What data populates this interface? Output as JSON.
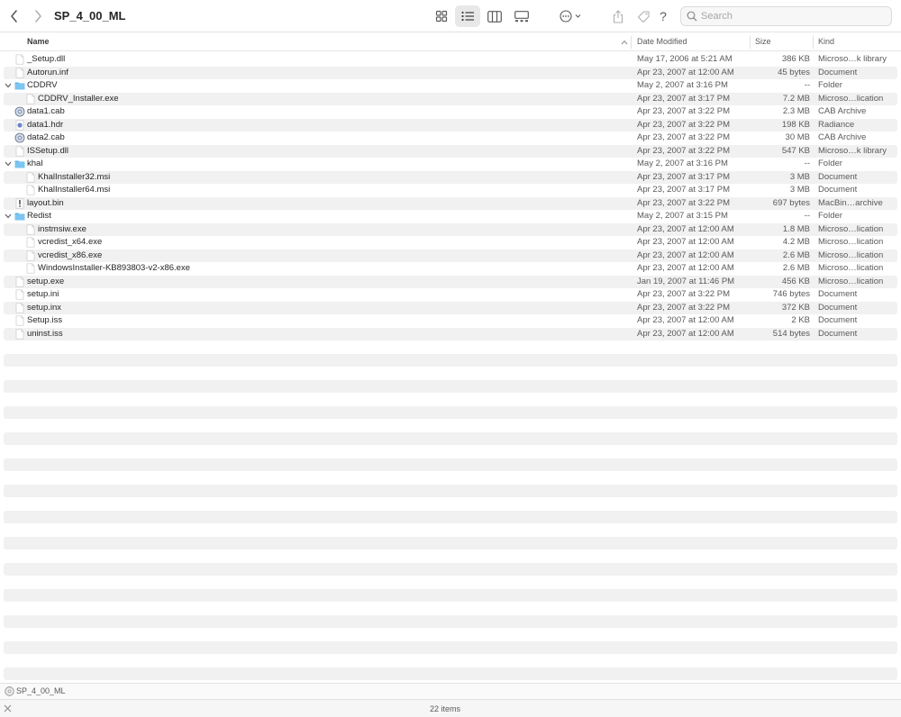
{
  "window": {
    "title": "SP_4_00_ML",
    "search_placeholder": "Search"
  },
  "toolbar": {
    "icons": [
      "back-chevron-icon",
      "forward-chevron-icon",
      "icon-view-icon",
      "list-view-icon",
      "column-view-icon",
      "gallery-view-icon",
      "action-more-icon",
      "share-icon",
      "tag-icon",
      "help-icon",
      "search-icon"
    ],
    "help_label": "?"
  },
  "columns": {
    "name": "Name",
    "date": "Date Modified",
    "size": "Size",
    "kind": "Kind"
  },
  "files": [
    {
      "name": "_Setup.dll",
      "date": "May 17, 2006 at 5:21 AM",
      "size": "386 KB",
      "kind": "Microso…k library",
      "icon": "doc",
      "depth": 0
    },
    {
      "name": "Autorun.inf",
      "date": "Apr 23, 2007 at 12:00 AM",
      "size": "45 bytes",
      "kind": "Document",
      "icon": "doc",
      "depth": 0
    },
    {
      "name": "CDDRV",
      "date": "May 2, 2007 at 3:16 PM",
      "size": "--",
      "kind": "Folder",
      "icon": "folder",
      "depth": 0,
      "expanded": true
    },
    {
      "name": "CDDRV_Installer.exe",
      "date": "Apr 23, 2007 at 3:17 PM",
      "size": "7.2 MB",
      "kind": "Microso…lication",
      "icon": "doc",
      "depth": 1
    },
    {
      "name": "data1.cab",
      "date": "Apr 23, 2007 at 3:22 PM",
      "size": "2.3 MB",
      "kind": "CAB Archive",
      "icon": "cab",
      "depth": 0
    },
    {
      "name": "data1.hdr",
      "date": "Apr 23, 2007 at 3:22 PM",
      "size": "198 KB",
      "kind": "Radiance",
      "icon": "hdr",
      "depth": 0
    },
    {
      "name": "data2.cab",
      "date": "Apr 23, 2007 at 3:22 PM",
      "size": "30 MB",
      "kind": "CAB Archive",
      "icon": "cab",
      "depth": 0
    },
    {
      "name": "ISSetup.dll",
      "date": "Apr 23, 2007 at 3:22 PM",
      "size": "547 KB",
      "kind": "Microso…k library",
      "icon": "doc",
      "depth": 0
    },
    {
      "name": "khal",
      "date": "May 2, 2007 at 3:16 PM",
      "size": "--",
      "kind": "Folder",
      "icon": "folder",
      "depth": 0,
      "expanded": true
    },
    {
      "name": "KhalInstaller32.msi",
      "date": "Apr 23, 2007 at 3:17 PM",
      "size": "3 MB",
      "kind": "Document",
      "icon": "doc",
      "depth": 1
    },
    {
      "name": "KhalInstaller64.msi",
      "date": "Apr 23, 2007 at 3:17 PM",
      "size": "3 MB",
      "kind": "Document",
      "icon": "doc",
      "depth": 1
    },
    {
      "name": "layout.bin",
      "date": "Apr 23, 2007 at 3:22 PM",
      "size": "697 bytes",
      "kind": "MacBin…archive",
      "icon": "bin",
      "depth": 0
    },
    {
      "name": "Redist",
      "date": "May 2, 2007 at 3:15 PM",
      "size": "--",
      "kind": "Folder",
      "icon": "folder",
      "depth": 0,
      "expanded": true
    },
    {
      "name": "instmsiw.exe",
      "date": "Apr 23, 2007 at 12:00 AM",
      "size": "1.8 MB",
      "kind": "Microso…lication",
      "icon": "doc",
      "depth": 1
    },
    {
      "name": "vcredist_x64.exe",
      "date": "Apr 23, 2007 at 12:00 AM",
      "size": "4.2 MB",
      "kind": "Microso…lication",
      "icon": "doc",
      "depth": 1
    },
    {
      "name": "vcredist_x86.exe",
      "date": "Apr 23, 2007 at 12:00 AM",
      "size": "2.6 MB",
      "kind": "Microso…lication",
      "icon": "doc",
      "depth": 1
    },
    {
      "name": "WindowsInstaller-KB893803-v2-x86.exe",
      "date": "Apr 23, 2007 at 12:00 AM",
      "size": "2.6 MB",
      "kind": "Microso…lication",
      "icon": "doc",
      "depth": 1
    },
    {
      "name": "setup.exe",
      "date": "Jan 19, 2007 at 11:46 PM",
      "size": "456 KB",
      "kind": "Microso…lication",
      "icon": "doc",
      "depth": 0
    },
    {
      "name": "setup.ini",
      "date": "Apr 23, 2007 at 3:22 PM",
      "size": "746 bytes",
      "kind": "Document",
      "icon": "doc",
      "depth": 0
    },
    {
      "name": "setup.inx",
      "date": "Apr 23, 2007 at 3:22 PM",
      "size": "372 KB",
      "kind": "Document",
      "icon": "doc",
      "depth": 0
    },
    {
      "name": "Setup.iss",
      "date": "Apr 23, 2007 at 12:00 AM",
      "size": "2 KB",
      "kind": "Document",
      "icon": "doc",
      "depth": 0
    },
    {
      "name": "uninst.iss",
      "date": "Apr 23, 2007 at 12:00 AM",
      "size": "514 bytes",
      "kind": "Document",
      "icon": "doc",
      "depth": 0
    }
  ],
  "pathbar": {
    "label": "SP_4_00_ML",
    "icon": "disc-icon"
  },
  "status": {
    "items_count": "22 items"
  },
  "colors": {
    "folder": "#5fb6ea",
    "stripe": "#f1f1f1",
    "text": "#262626",
    "secondary_text": "#5a5a5a"
  }
}
